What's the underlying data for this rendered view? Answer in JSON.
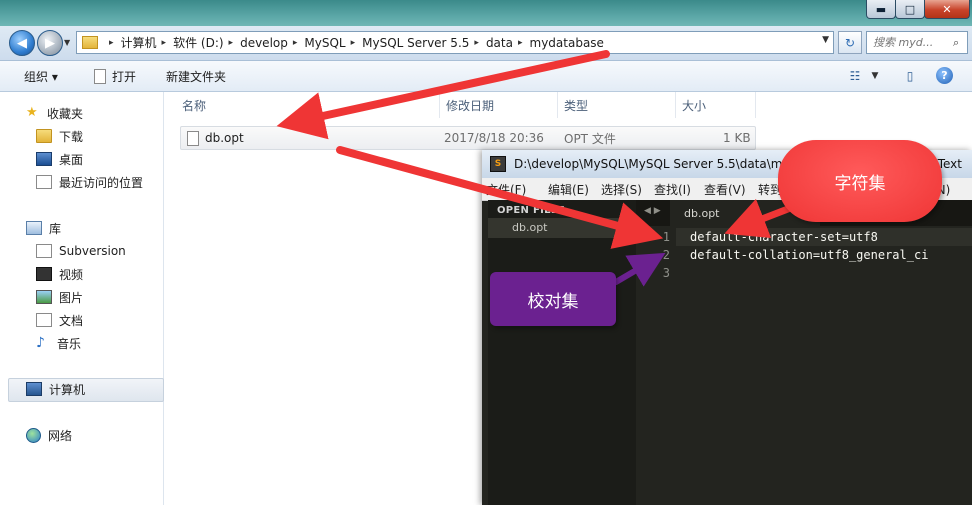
{
  "titlebar": {
    "minimize": "▬",
    "maximize": "□",
    "close": "✕"
  },
  "address": {
    "breadcrumbs": [
      "计算机",
      "软件 (D:)",
      "develop",
      "MySQL",
      "MySQL Server 5.5",
      "data",
      "mydatabase"
    ],
    "search_placeholder": "搜索 myd..."
  },
  "toolbar": {
    "organize": "组织 ▾",
    "open": "打开",
    "new_folder": "新建文件夹"
  },
  "sidebar": {
    "favorites": {
      "label": "收藏夹",
      "items": [
        "下载",
        "桌面",
        "最近访问的位置"
      ]
    },
    "libraries": {
      "label": "库",
      "items": [
        "Subversion",
        "视频",
        "图片",
        "文档",
        "音乐"
      ]
    },
    "computer": "计算机",
    "network": "网络"
  },
  "file_list": {
    "columns": [
      "名称",
      "修改日期",
      "类型",
      "大小"
    ],
    "rows": [
      {
        "name": "db.opt",
        "modified": "2017/8/18 20:36",
        "type": "OPT 文件",
        "size": "1 KB"
      }
    ]
  },
  "editor": {
    "title": "D:\\develop\\MySQL\\MySQL Server 5.5\\data\\myd",
    "title_tail": "Text",
    "menu": [
      "文件(F)",
      "编辑(E)",
      "选择(S)",
      "查找(I)",
      "查看(V)",
      "转到",
      "帮助(N)"
    ],
    "open_files_label": "OPEN FILES",
    "open_file": "db.opt",
    "tab": "db.opt",
    "lines": [
      {
        "no": "1",
        "text": "default-character-set=utf8"
      },
      {
        "no": "2",
        "text": "default-collation=utf8_general_ci"
      },
      {
        "no": "3",
        "text": ""
      }
    ]
  },
  "annotations": {
    "charset": "字符集",
    "collation": "校对集",
    "colors": {
      "red": "#ef3535",
      "purple": "#6b2190"
    }
  }
}
